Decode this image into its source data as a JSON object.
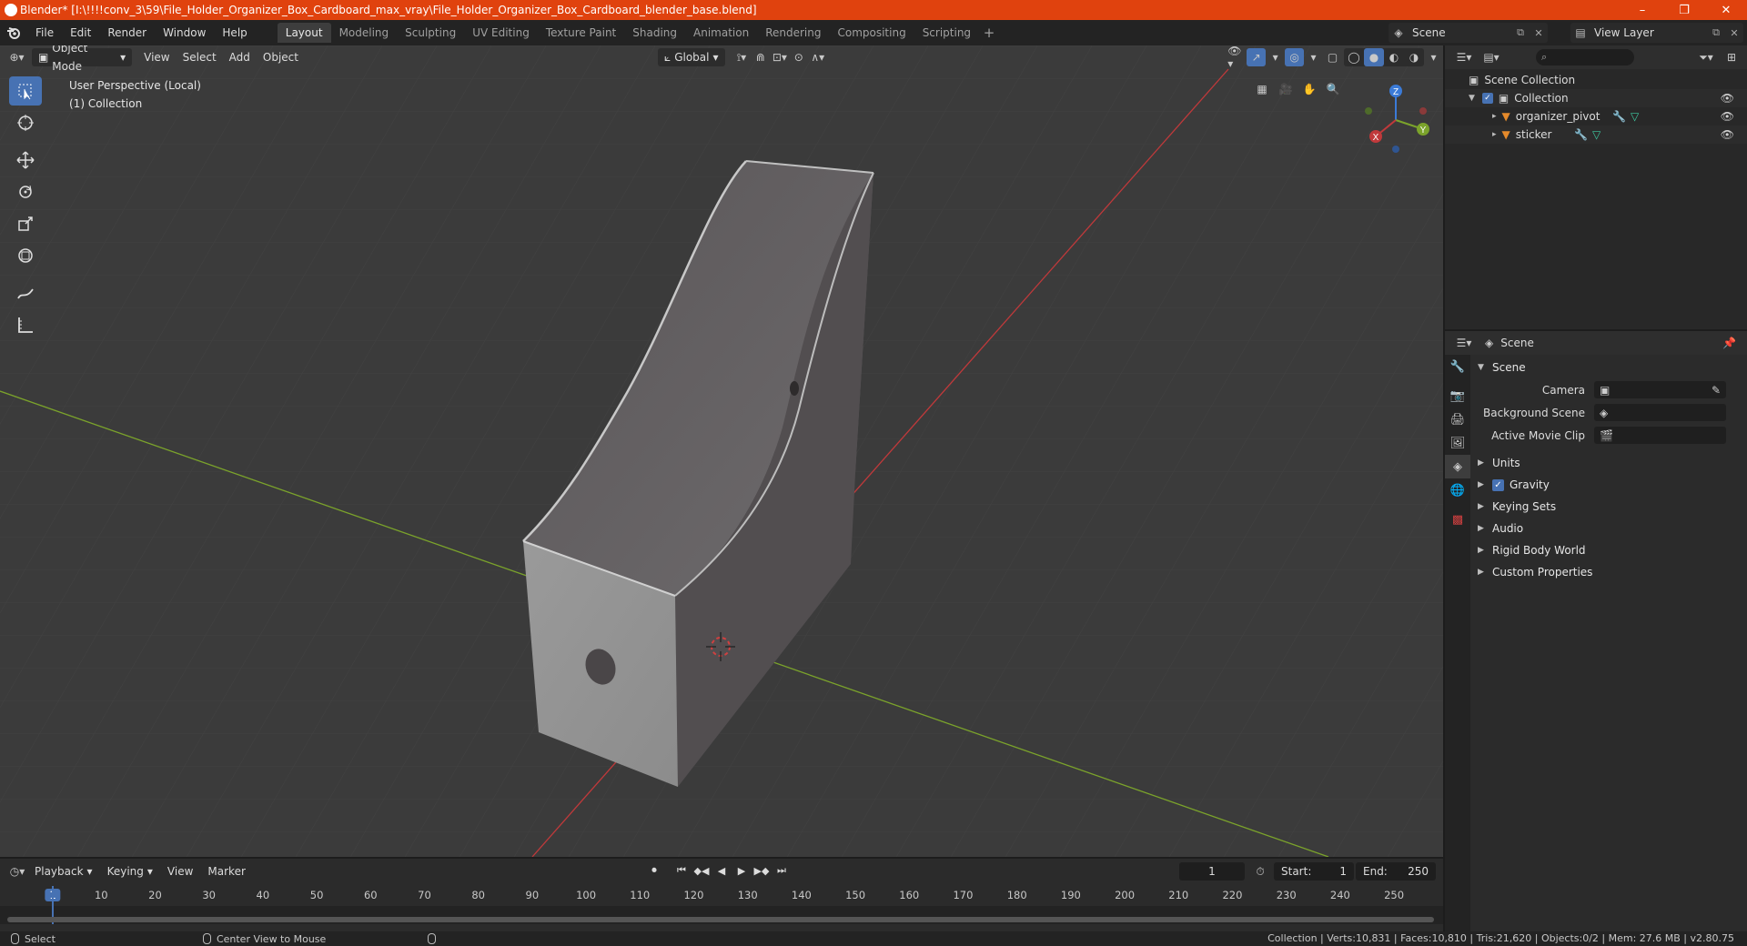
{
  "window": {
    "title": "Blender* [I:\\!!!!conv_3\\59\\File_Holder_Organizer_Box_Cardboard_max_vray\\File_Holder_Organizer_Box_Cardboard_blender_base.blend]",
    "minimize": "–",
    "maximize": "❐",
    "close": "✕"
  },
  "menu": {
    "file": "File",
    "edit": "Edit",
    "render": "Render",
    "window": "Window",
    "help": "Help"
  },
  "workspaces": [
    "Layout",
    "Modeling",
    "Sculpting",
    "UV Editing",
    "Texture Paint",
    "Shading",
    "Animation",
    "Rendering",
    "Compositing",
    "Scripting"
  ],
  "active_workspace": "Layout",
  "scene_selector": {
    "value": "Scene"
  },
  "viewlayer_selector": {
    "value": "View Layer"
  },
  "viewport": {
    "mode": "Object Mode",
    "menus": {
      "view": "View",
      "select": "Select",
      "add": "Add",
      "object": "Object"
    },
    "transform_orientation": "Global",
    "info_line1": "User Perspective (Local)",
    "info_line2": "(1) Collection",
    "gizmo": {
      "x": "X",
      "y": "Y",
      "z": "Z"
    }
  },
  "outliner": {
    "root": "Scene Collection",
    "collection": "Collection",
    "objects": [
      "organizer_pivot",
      "sticker"
    ]
  },
  "properties": {
    "context": "Scene",
    "panel": "Scene",
    "fields": {
      "camera_label": "Camera",
      "background_scene_label": "Background Scene",
      "active_movie_clip_label": "Active Movie Clip"
    },
    "panels": [
      "Units",
      "Gravity",
      "Keying Sets",
      "Audio",
      "Rigid Body World",
      "Custom Properties"
    ]
  },
  "timeline": {
    "menus": {
      "playback": "Playback",
      "keying": "Keying",
      "view": "View",
      "marker": "Marker"
    },
    "current_frame": "1",
    "start_label": "Start:",
    "start": "1",
    "end_label": "End:",
    "end": "250",
    "ticks": [
      "1",
      "10",
      "20",
      "30",
      "40",
      "50",
      "60",
      "70",
      "80",
      "90",
      "100",
      "110",
      "120",
      "130",
      "140",
      "150",
      "160",
      "170",
      "180",
      "190",
      "200",
      "210",
      "220",
      "230",
      "240",
      "250"
    ]
  },
  "statusbar": {
    "select": "Select",
    "center_view": "Center View to Mouse",
    "stats": "Collection | Verts:10,831 | Faces:10,810 | Tris:21,620 | Objects:0/2 | Mem: 27.6 MB | v2.80.75"
  },
  "colors": {
    "titlebar": "#e0420e",
    "accent": "#4772b3",
    "viewport_bg": "#3b3b3b",
    "x_axis": "#c0393b",
    "y_axis": "#7ba32b",
    "z_axis": "#3b7bd8"
  }
}
